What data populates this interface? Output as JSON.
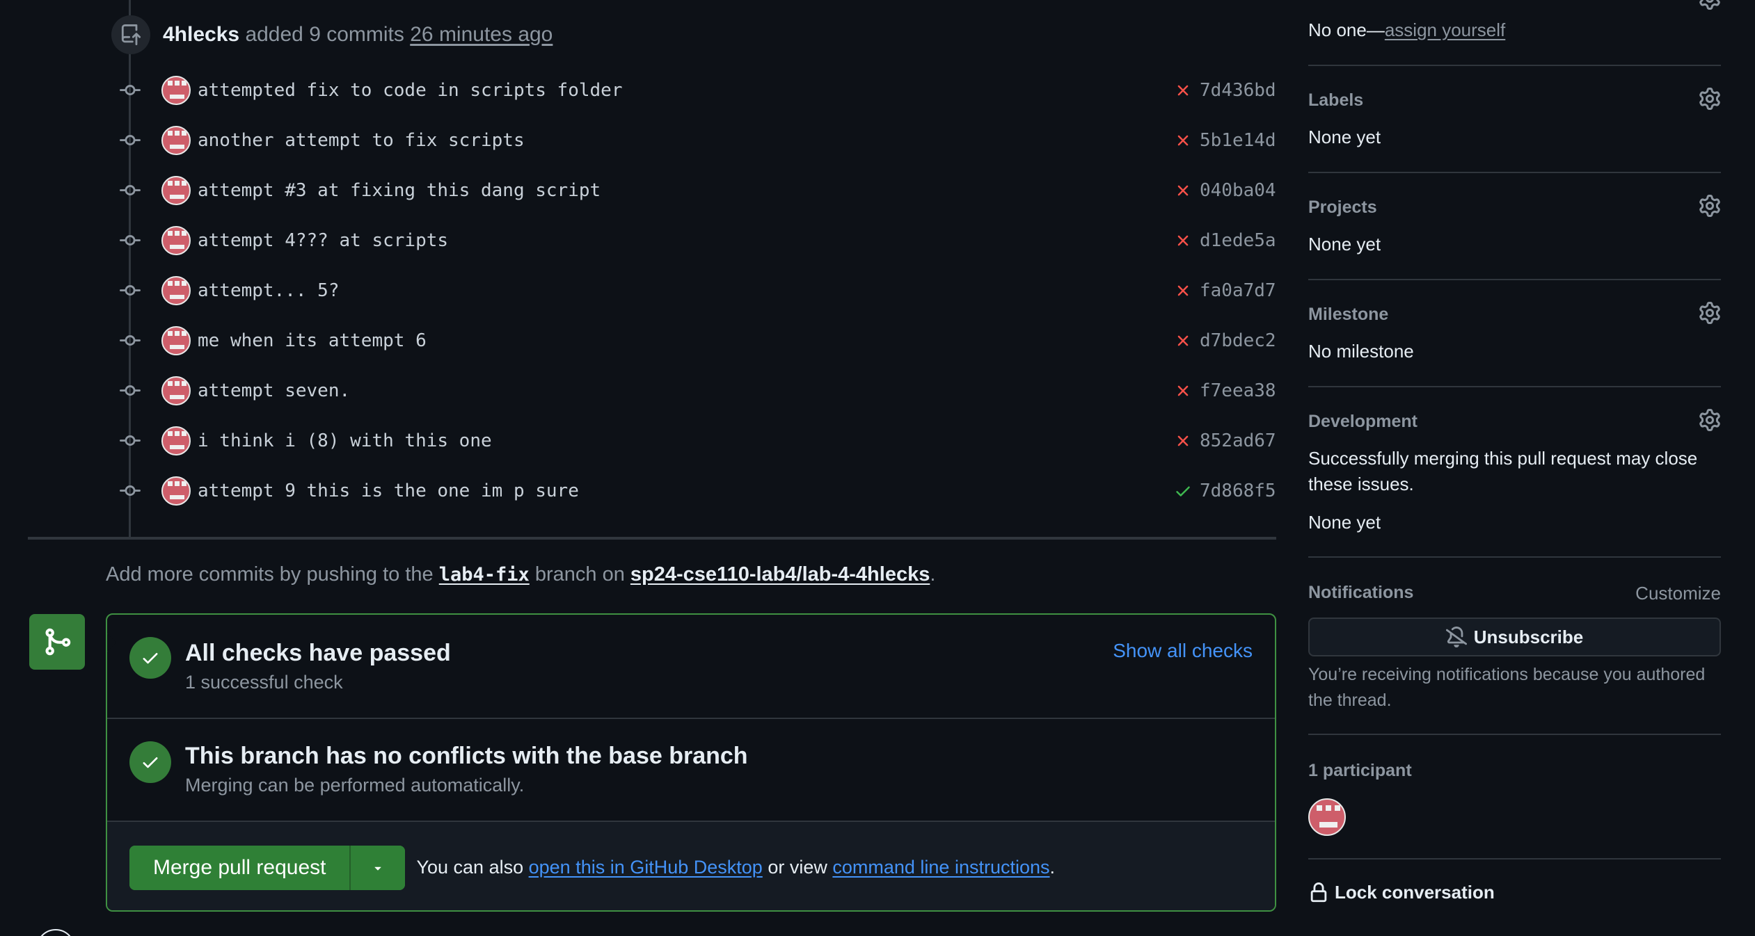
{
  "timeline": {
    "push_event": {
      "author": "4hlecks",
      "action": "added 9 commits",
      "time": "26 minutes ago"
    },
    "commits": [
      {
        "message": "attempted fix to code in scripts folder",
        "sha": "7d436bd",
        "status": "failed"
      },
      {
        "message": "another attempt to fix scripts",
        "sha": "5b1e14d",
        "status": "failed"
      },
      {
        "message": "attempt #3 at fixing this dang script",
        "sha": "040ba04",
        "status": "failed"
      },
      {
        "message": "attempt 4??? at scripts",
        "sha": "d1ede5a",
        "status": "failed"
      },
      {
        "message": "attempt... 5?",
        "sha": "fa0a7d7",
        "status": "failed"
      },
      {
        "message": "me when its attempt 6",
        "sha": "d7bdec2",
        "status": "failed"
      },
      {
        "message": "attempt seven.",
        "sha": "f7eea38",
        "status": "failed"
      },
      {
        "message": "i think i (8) with this one",
        "sha": "852ad67",
        "status": "failed"
      },
      {
        "message": "attempt 9 this is the one im p sure",
        "sha": "7d868f5",
        "status": "passed"
      }
    ]
  },
  "hint": {
    "prefix": "Add more commits by pushing to the",
    "branch": "lab4-fix",
    "middle": "branch on",
    "repo": "sp24-cse110-lab4/lab-4-4hlecks",
    "suffix": "."
  },
  "merge_box": {
    "checks": {
      "title": "All checks have passed",
      "subtitle": "1 successful check",
      "show_all": "Show all checks"
    },
    "conflicts": {
      "title": "This branch has no conflicts with the base branch",
      "subtitle": "Merging can be performed automatically."
    },
    "footer": {
      "merge_button": "Merge pull request",
      "text_prefix": "You can also",
      "desktop_link": "open this in GitHub Desktop",
      "text_middle": "or view",
      "cli_link": "command line instructions",
      "text_suffix": "."
    }
  },
  "sidebar": {
    "assignees": {
      "value_prefix": "No one—",
      "assign_link": "assign yourself"
    },
    "labels": {
      "heading": "Labels",
      "value": "None yet"
    },
    "projects": {
      "heading": "Projects",
      "value": "None yet"
    },
    "milestone": {
      "heading": "Milestone",
      "value": "No milestone"
    },
    "development": {
      "heading": "Development",
      "description": "Successfully merging this pull request may close these issues.",
      "value": "None yet"
    },
    "notifications": {
      "heading": "Notifications",
      "customize": "Customize",
      "unsubscribe": "Unsubscribe",
      "reason": "You’re receiving notifications because you authored the thread."
    },
    "participants": {
      "heading": "1 participant"
    },
    "lock": {
      "label": "Lock conversation"
    }
  },
  "colors": {
    "background": "#0d1117",
    "accent_green": "#347d39",
    "link_blue": "#4493f8",
    "fail_red": "#f85149",
    "pass_green": "#3fb950"
  },
  "icons": {
    "push": "repo-push-icon",
    "commit": "git-commit-icon",
    "fail": "x-icon",
    "pass": "check-icon",
    "merge": "git-merge-icon",
    "gear": "gear-icon",
    "bell_slash": "bell-slash-icon",
    "lock": "lock-icon",
    "caret": "triangle-down-icon"
  }
}
